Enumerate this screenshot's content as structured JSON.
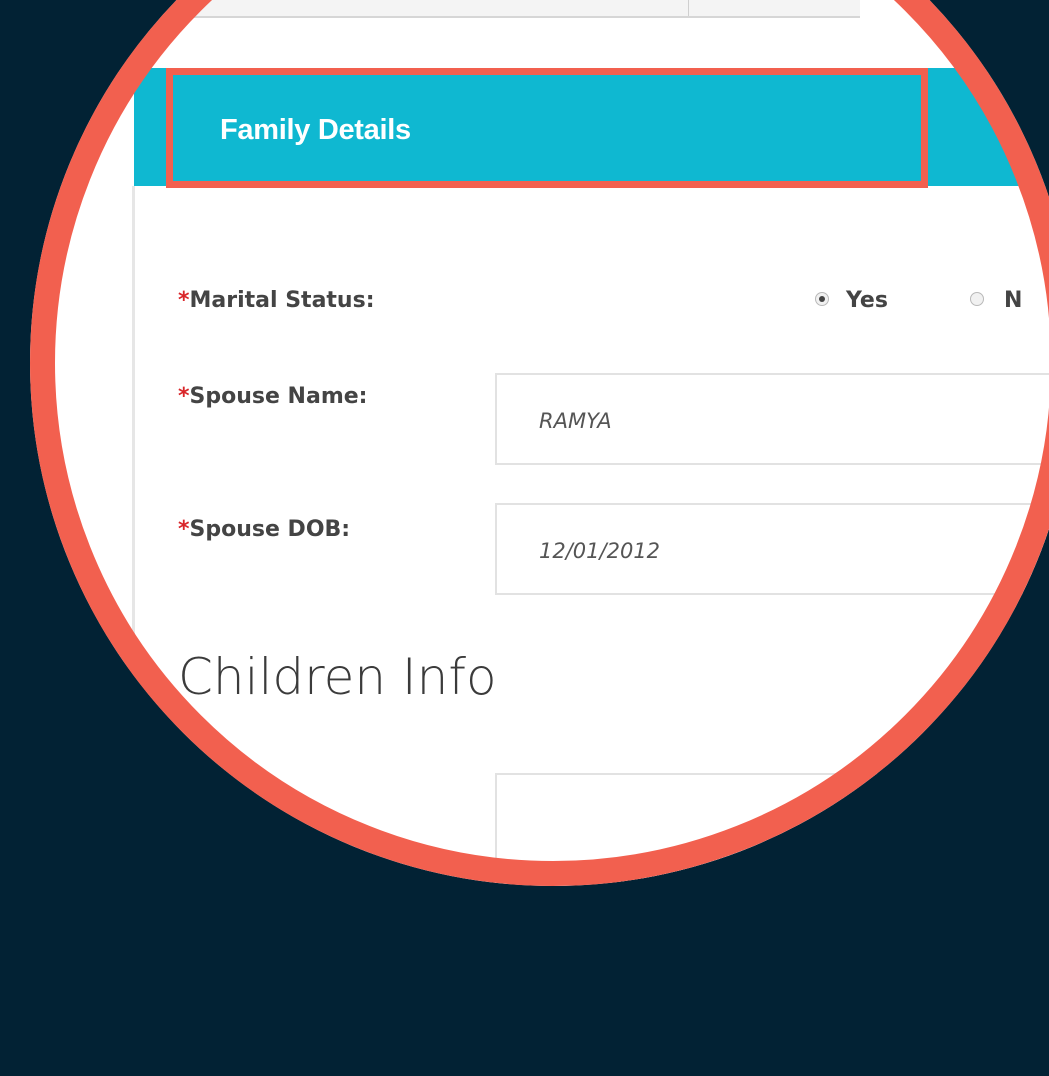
{
  "section": {
    "title": "Family Details"
  },
  "marital_status": {
    "label": "Marital Status:",
    "required_mark": "*",
    "options": [
      {
        "label": "Yes",
        "checked": true
      },
      {
        "label": "N",
        "checked": false
      }
    ]
  },
  "spouse_name": {
    "label": "Spouse Name:",
    "required_mark": "*",
    "value": "RAMYA"
  },
  "spouse_dob": {
    "label": "Spouse DOB:",
    "required_mark": "*",
    "value": "12/01/2012"
  },
  "children": {
    "title": "Children Info"
  },
  "colors": {
    "background": "#022234",
    "highlight": "#f2604f",
    "header": "#0fb8d1",
    "required": "#d9262a"
  }
}
